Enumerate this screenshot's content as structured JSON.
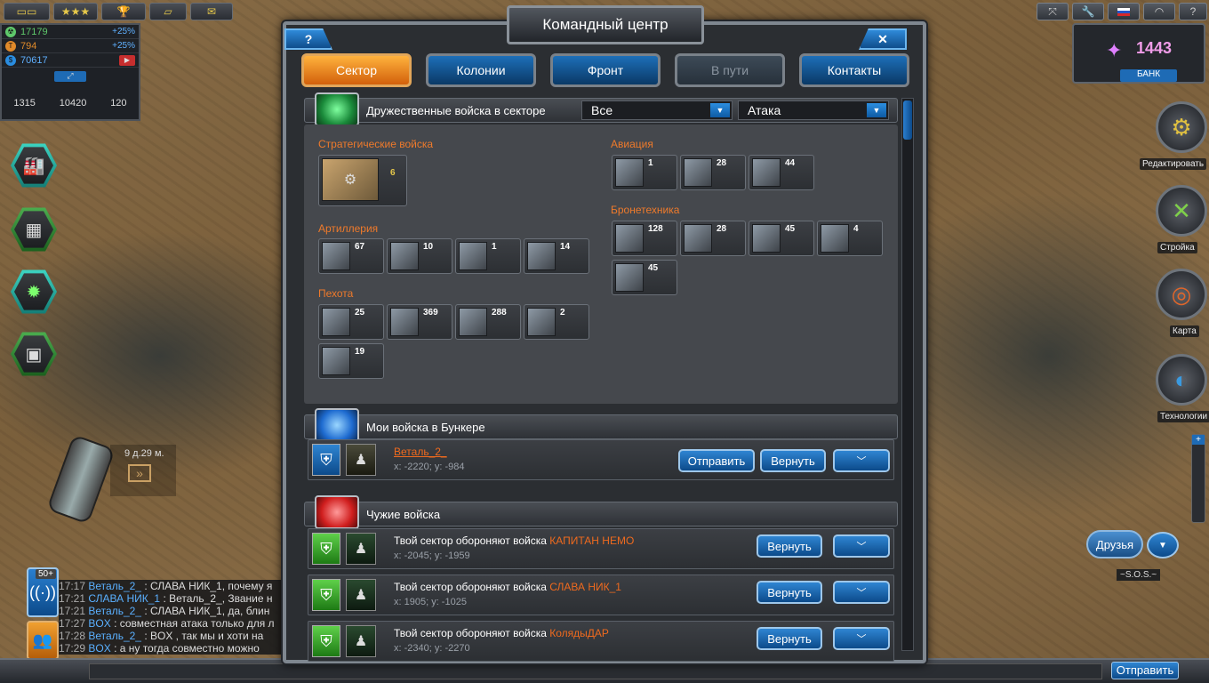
{
  "hud": {
    "resources": [
      {
        "value": "17179",
        "pct": "+25%",
        "color": "#5fc96b",
        "icon": "flask-icon"
      },
      {
        "value": "794",
        "pct": "+25%",
        "color": "#e08a2a",
        "icon": "oil-icon"
      },
      {
        "value": "70617",
        "pct": "",
        "color": "#2a8de0",
        "icon": "dollar-icon"
      }
    ],
    "stats": [
      "1315",
      "10420",
      "120"
    ],
    "crystals": "1443",
    "bank_label": "БАНК"
  },
  "side_menu": {
    "edit": "Редактировать",
    "build": "Стройка",
    "map": "Карта",
    "tech": "Технологии"
  },
  "timer": "9 д.29 м.",
  "friends": {
    "label": "Друзья",
    "sos": "~S.O.S.~"
  },
  "chat": {
    "badge": "50+",
    "lines": [
      {
        "t": "17:17",
        "n": "Веталь_2_",
        "m": ": СЛАВА НИК_1, почему я"
      },
      {
        "t": "17:21",
        "n": "СЛАВА НИК_1",
        "m": ": Веталь_2_, Звание н"
      },
      {
        "t": "17:21",
        "n": "Веталь_2_",
        "m": ": СЛАВА НИК_1, да, блин"
      },
      {
        "t": "17:27",
        "n": "BOX",
        "m": ": совместная атака только для л"
      },
      {
        "t": "17:28",
        "n": "Веталь_2_",
        "m": ": BOX , так мы и хоти на"
      },
      {
        "t": "17:29",
        "n": "BOX",
        "m": ": а ну тогда совместно можно"
      }
    ],
    "send": "Отправить"
  },
  "modal": {
    "title": "Командный центр",
    "help": "?",
    "close": "✕",
    "tabs": [
      "Сектор",
      "Колонии",
      "Фронт",
      "В пути",
      "Контакты"
    ],
    "friendly": {
      "label": "Дружественные войска в секторе",
      "filter1": "Все",
      "filter2": "Атака",
      "categories": {
        "strategic": {
          "label": "Стратегические войска",
          "units": [
            "6"
          ]
        },
        "artillery": {
          "label": "Артиллерия",
          "units": [
            "67",
            "10",
            "1",
            "14"
          ]
        },
        "infantry": {
          "label": "Пехота",
          "units": [
            "25",
            "369",
            "288",
            "2",
            "19"
          ]
        },
        "aviation": {
          "label": "Авиация",
          "units": [
            "1",
            "28",
            "44"
          ]
        },
        "armor": {
          "label": "Бронетехника",
          "units": [
            "128",
            "28",
            "45",
            "4",
            "45"
          ]
        }
      }
    },
    "bunker": {
      "label": "Мои войска в Бункере",
      "player": "Веталь_2_",
      "coords": "x: -2220; y: -984",
      "send": "Отправить",
      "ret": "Вернуть"
    },
    "foreign": {
      "label": "Чужие войска",
      "rows": [
        {
          "text": "Твой сектор обороняют войска ",
          "name": "КАПИТАН НЕМО",
          "coords": "x: -2045; y: -1959",
          "btn": "Вернуть"
        },
        {
          "text": "Твой сектор обороняют войска ",
          "name": "СЛАВА НИК_1",
          "coords": "x: 1905; y: -1025",
          "btn": "Вернуть"
        },
        {
          "text": "Твой сектор обороняют войска ",
          "name": "КолядыДАР",
          "coords": "x: -2340; y: -2270",
          "btn": "Вернуть"
        }
      ]
    }
  }
}
